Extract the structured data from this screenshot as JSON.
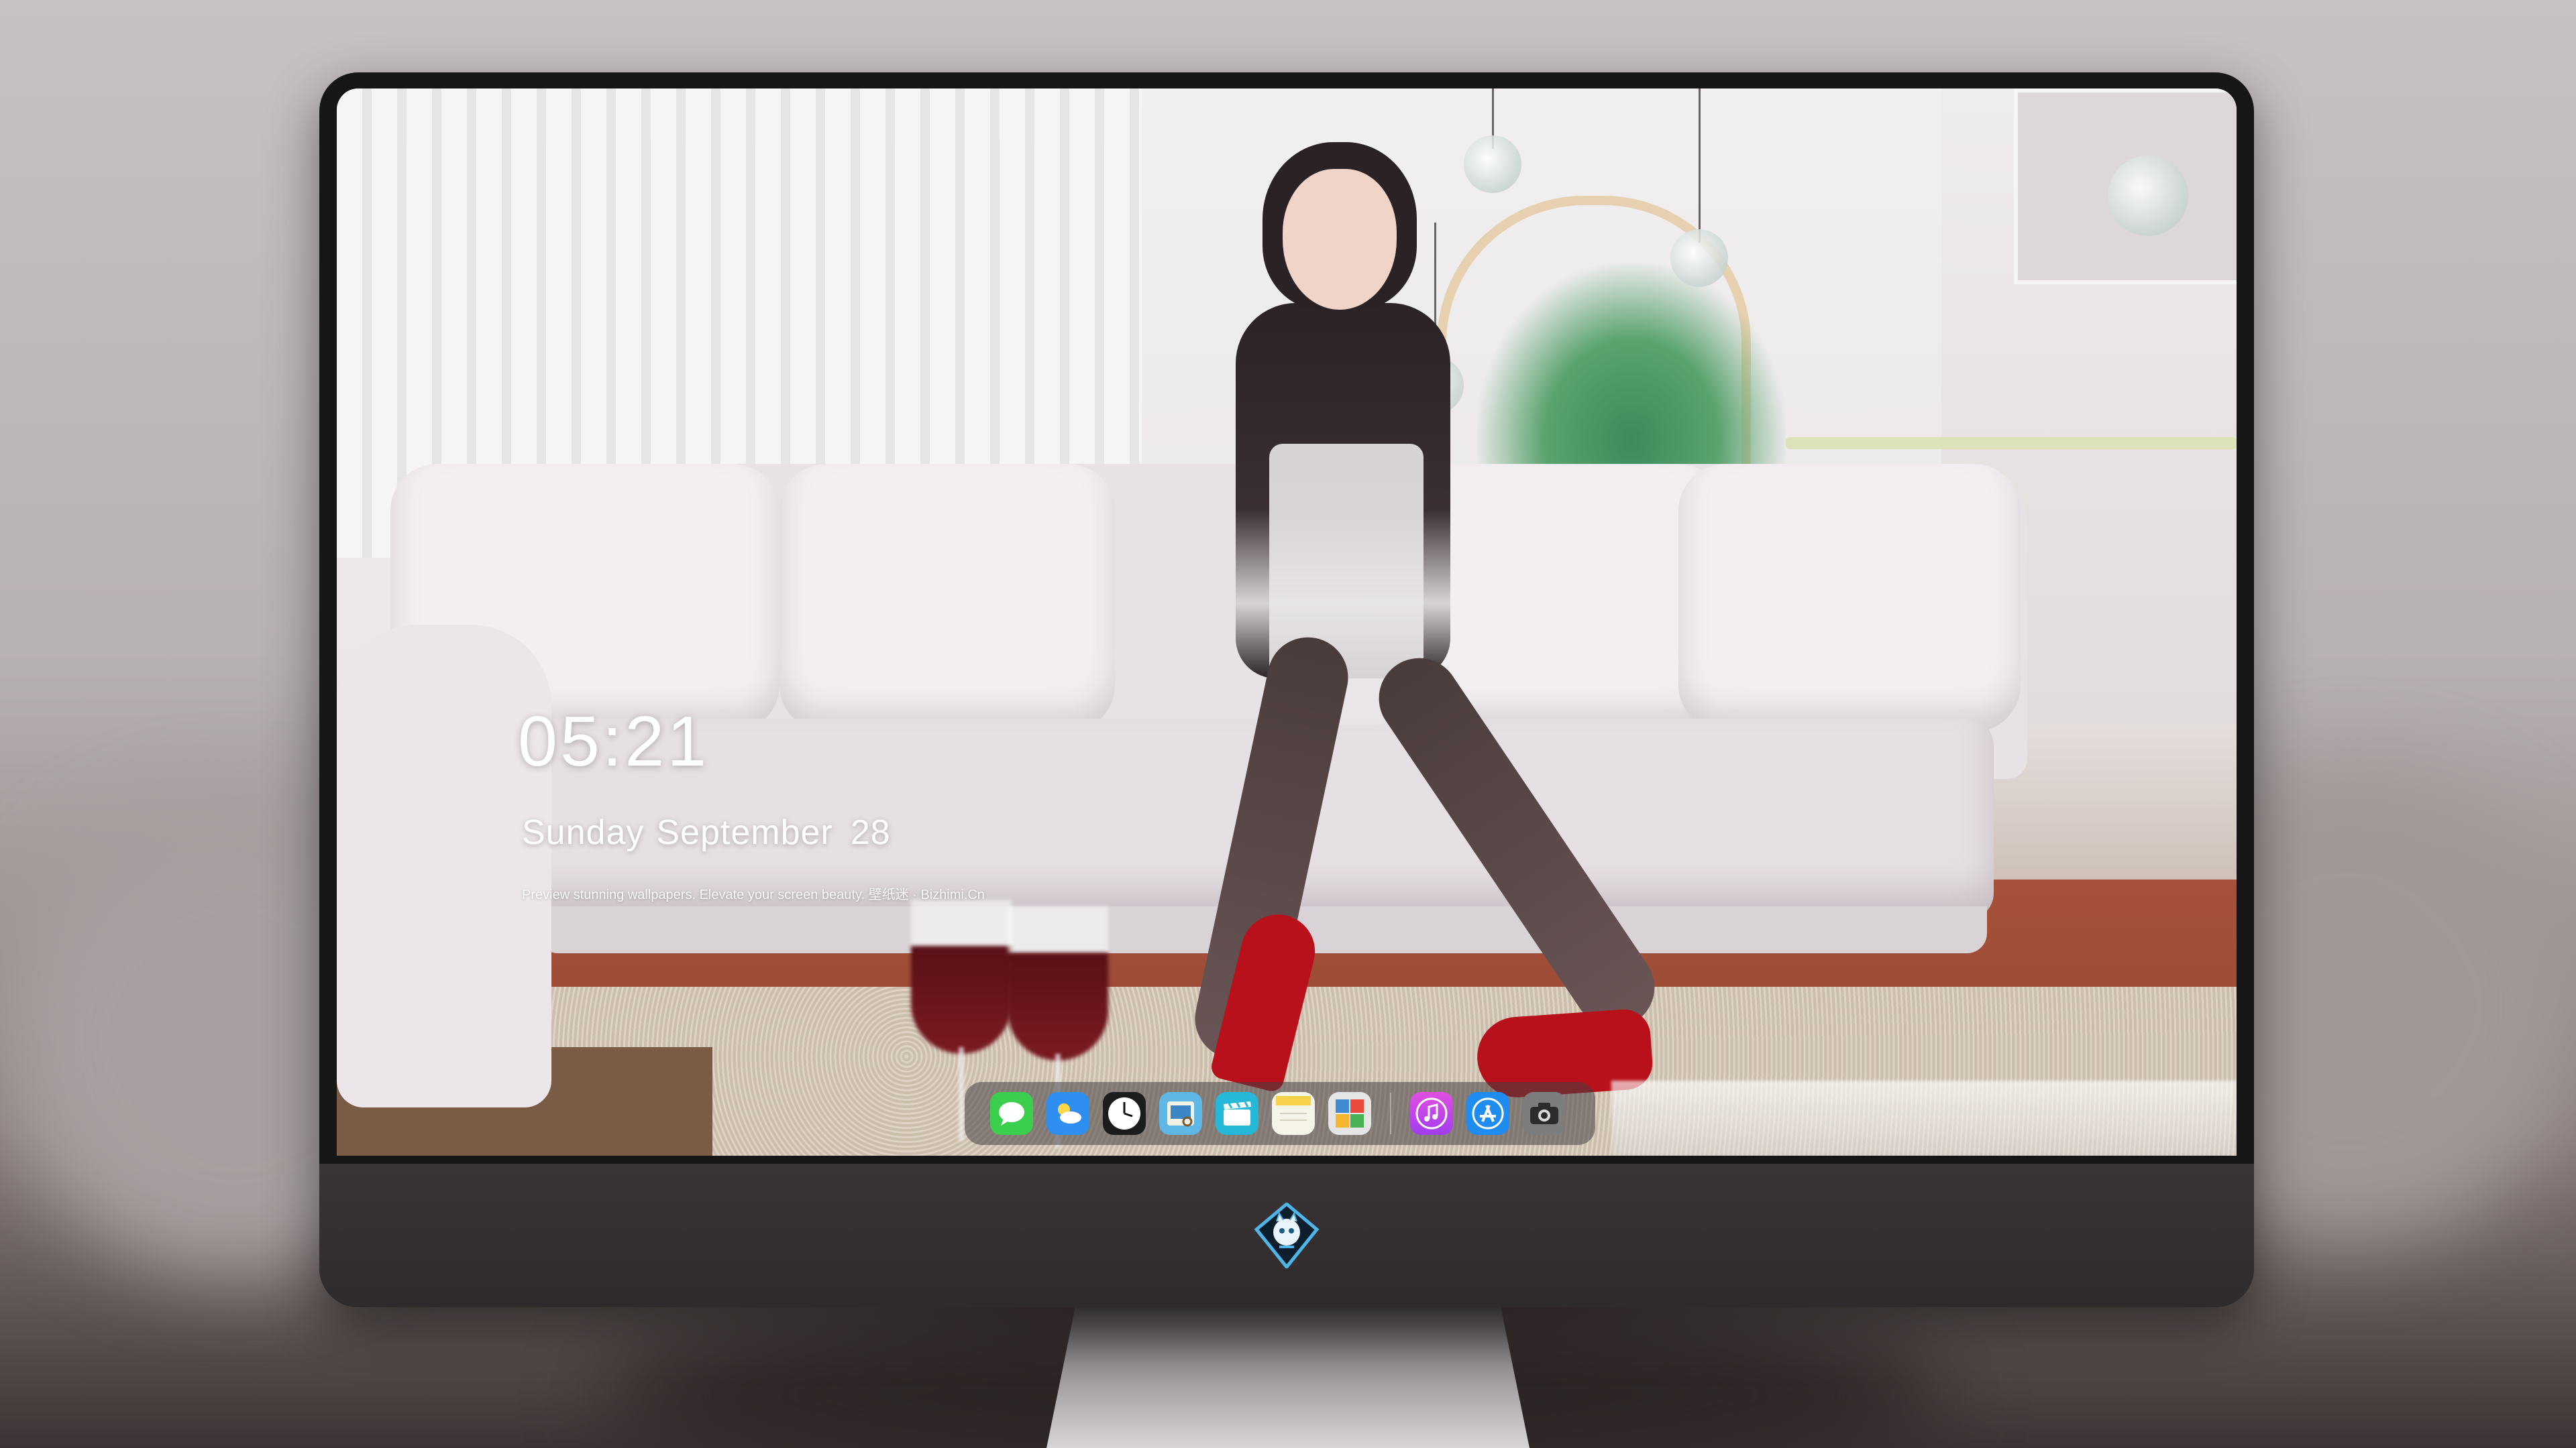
{
  "lock_screen": {
    "time": "05:21",
    "weekday": "Sunday",
    "month": "September",
    "day": "28",
    "tagline": "Preview stunning wallpapers. Elevate your screen beauty. 壁纸迷 · Bizhimi.Cn"
  },
  "dock": {
    "apps": [
      {
        "name": "messages-icon",
        "color": "#3ccf4e"
      },
      {
        "name": "weather-icon",
        "color": "#2f8ff0"
      },
      {
        "name": "clock-icon",
        "color": "#1c1c1c"
      },
      {
        "name": "preview-icon",
        "color": "#5fb7e5"
      },
      {
        "name": "clips-icon",
        "color": "#25b8d8"
      },
      {
        "name": "notes-icon",
        "color": "#f6d34a"
      },
      {
        "name": "photo-booth-icon",
        "color": "#e5e5e5"
      },
      {
        "name": "music-icon",
        "color": "#c94ce6"
      },
      {
        "name": "app-store-icon",
        "color": "#1e8cf0"
      },
      {
        "name": "camera-icon",
        "color": "#8a8a8a"
      }
    ]
  },
  "monitor": {
    "logo": "monitor-logo-icon"
  }
}
